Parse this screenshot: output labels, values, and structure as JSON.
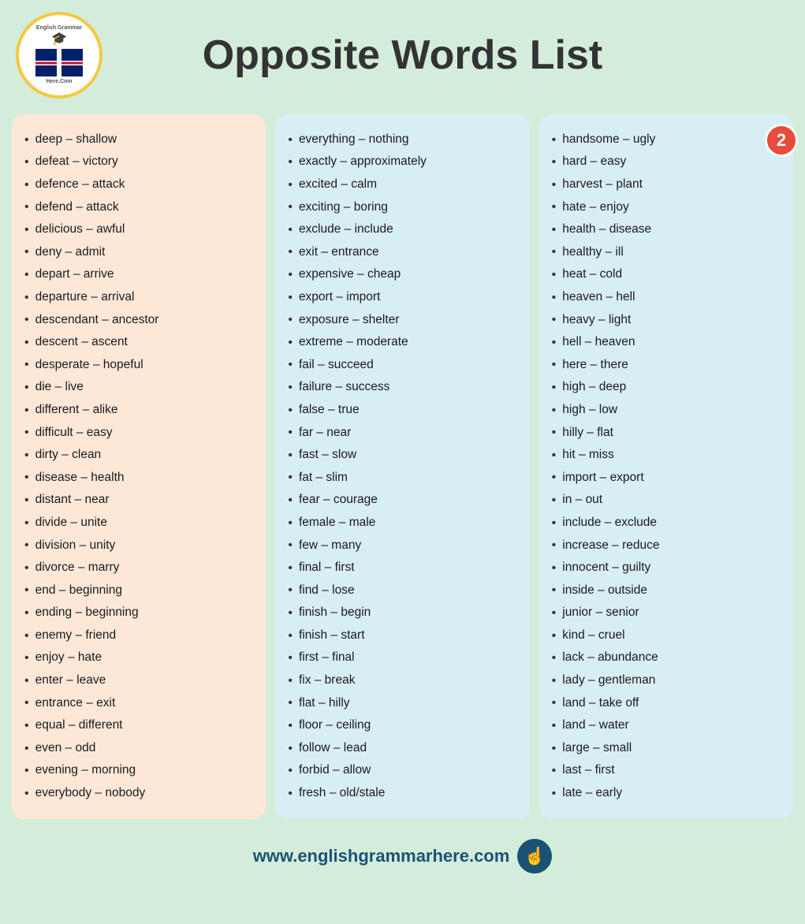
{
  "header": {
    "title": "Opposite Words List",
    "logo_top": "English Grammar",
    "logo_bottom": "Here.Com"
  },
  "badge": "2",
  "footer": {
    "url": "www.englishgrammarhere.com"
  },
  "columns": [
    {
      "id": "col1",
      "items": [
        "deep – shallow",
        "defeat – victory",
        "defence – attack",
        "defend – attack",
        "delicious – awful",
        "deny – admit",
        "depart – arrive",
        "departure – arrival",
        "descendant – ancestor",
        "descent – ascent",
        "desperate – hopeful",
        "die – live",
        "different – alike",
        "difficult – easy",
        "dirty – clean",
        "disease – health",
        "distant – near",
        "divide – unite",
        "division – unity",
        "divorce – marry",
        "end – beginning",
        "ending – beginning",
        "enemy – friend",
        "enjoy – hate",
        "enter – leave",
        "entrance – exit",
        "equal – different",
        "even – odd",
        "evening – morning",
        "everybody – nobody"
      ]
    },
    {
      "id": "col2",
      "items": [
        "everything – nothing",
        "exactly – approximately",
        "excited – calm",
        "exciting – boring",
        "exclude – include",
        "exit – entrance",
        "expensive – cheap",
        "export – import",
        "exposure – shelter",
        "extreme – moderate",
        "fail – succeed",
        "failure – success",
        "false – true",
        "far – near",
        "fast – slow",
        "fat – slim",
        "fear – courage",
        "female – male",
        "few – many",
        "final – first",
        "find – lose",
        "finish – begin",
        "finish – start",
        "first – final",
        "fix – break",
        "flat – hilly",
        "floor – ceiling",
        "follow – lead",
        "forbid – allow",
        "fresh – old/stale"
      ]
    },
    {
      "id": "col3",
      "items": [
        "handsome – ugly",
        "hard – easy",
        "harvest – plant",
        "hate – enjoy",
        "health – disease",
        "healthy – ill",
        "heat – cold",
        "heaven – hell",
        "heavy – light",
        "hell – heaven",
        "here – there",
        "high – deep",
        "high – low",
        "hilly – flat",
        "hit – miss",
        "import – export",
        "in – out",
        "include – exclude",
        "increase – reduce",
        "innocent – guilty",
        "inside – outside",
        "junior – senior",
        "kind – cruel",
        "lack – abundance",
        "lady – gentleman",
        "land – take off",
        "land – water",
        "large – small",
        "last – first",
        "late – early"
      ]
    }
  ]
}
